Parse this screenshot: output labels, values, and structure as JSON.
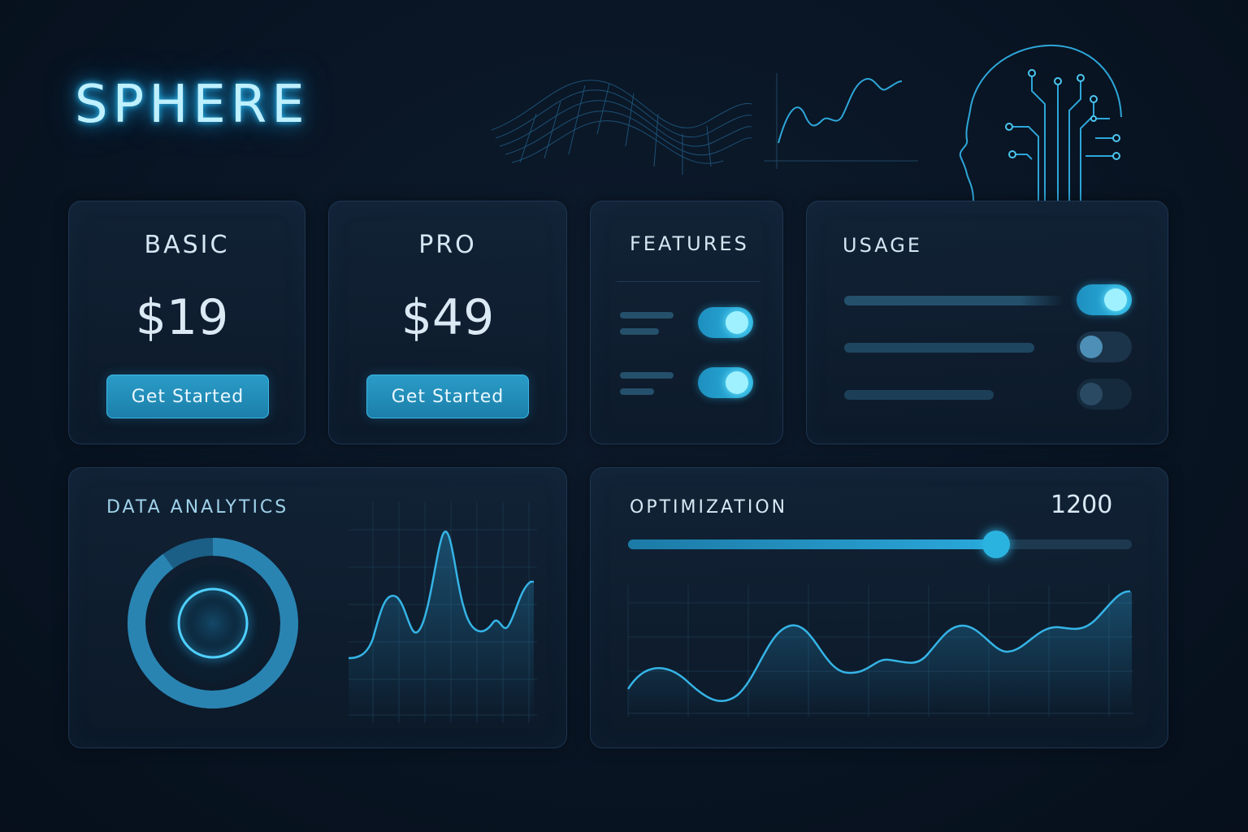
{
  "brand": {
    "name": "SPHERE"
  },
  "pricing": [
    {
      "plan": "BASIC",
      "price": "$19",
      "cta": "Get Started"
    },
    {
      "plan": "PRO",
      "price": "$49",
      "cta": "Get Started"
    }
  ],
  "features": {
    "title": "FEATURES",
    "toggles": [
      {
        "state": "on"
      },
      {
        "state": "on"
      }
    ]
  },
  "usage": {
    "title": "USAGE",
    "rows": [
      {
        "toggle": "on"
      },
      {
        "toggle": "partial"
      },
      {
        "toggle": "off"
      }
    ]
  },
  "analytics": {
    "title": "DATA ANALYTICS",
    "ring_progress": 0.9
  },
  "optimization": {
    "title": "OPTIMIZATION",
    "value": "1200",
    "slider_fraction": 0.73
  },
  "colors": {
    "accent": "#2bb3e0",
    "glow": "#6ee6ff",
    "background": "#091524",
    "card_border": "#1e3550"
  },
  "icons": [
    "wireframe-wave-graphic",
    "line-chart-graphic",
    "ai-head-circuit-icon",
    "donut-ring-icon"
  ]
}
